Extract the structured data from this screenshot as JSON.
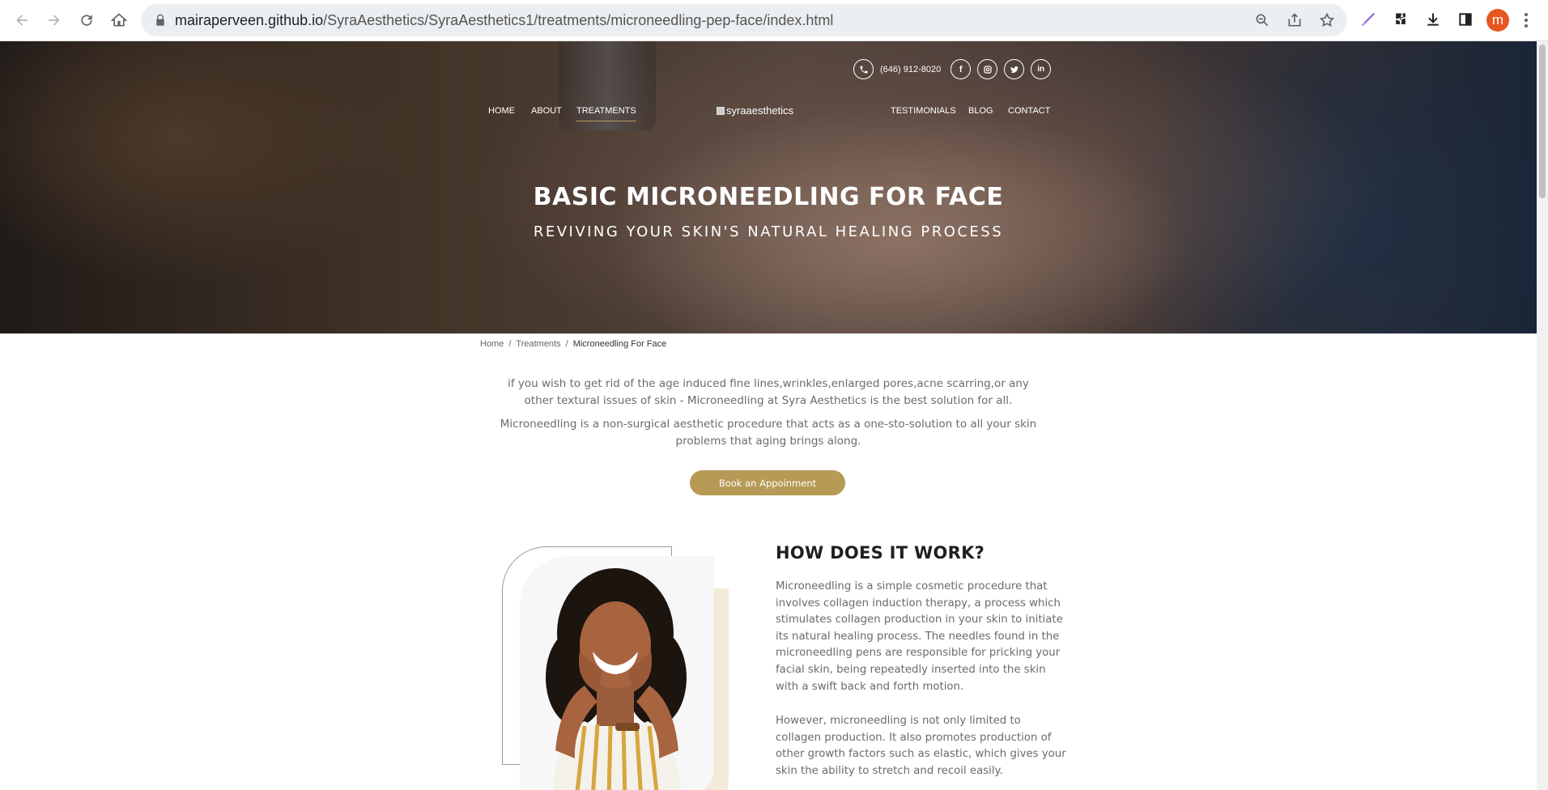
{
  "browser": {
    "url_host": "mairaperveen.github.io",
    "url_path": "/SyraAesthetics/SyraAesthetics1/treatments/microneedling-pep-face/index.html",
    "profile_initial": "m",
    "accent": "#e8561f"
  },
  "topbar": {
    "phone": "(646) 912-8020",
    "social": [
      {
        "icon": "facebook-icon",
        "glyph": "f"
      },
      {
        "icon": "instagram-icon"
      },
      {
        "icon": "twitter-icon"
      },
      {
        "icon": "linkedin-icon",
        "glyph": "in"
      }
    ]
  },
  "nav": {
    "left": [
      "HOME",
      "ABOUT",
      "TREATMENTS"
    ],
    "right": [
      "TESTIMONIALS",
      "BLOG",
      "CONTACT"
    ],
    "active": "TREATMENTS",
    "logo_alt": "syraaesthetics"
  },
  "hero": {
    "title": "BASIC MICRONEEDLING FOR FACE",
    "subtitle": "REVIVING YOUR SKIN'S NATURAL HEALING PROCESS"
  },
  "breadcrumb": {
    "items": [
      "Home",
      "Treatments"
    ],
    "separator": "/",
    "current": "Microneedling For Face"
  },
  "intro": {
    "p1": "if you wish to get rid of the age induced fine lines,wrinkles,enlarged pores,acne scarring,or any other textural issues of skin - Microneedling at Syra Aesthetics is the best solution for all.",
    "p2": "Microneedling is a non-surgical aesthetic procedure that acts as a one-sto-solution to all your skin problems that aging brings along.",
    "cta": "Book an Appoinment"
  },
  "how": {
    "title": "HOW DOES IT WORK?",
    "p1": "Microneedling is a simple cosmetic procedure that involves collagen induction therapy, a process which stimulates collagen production in your skin to initiate its natural healing process. The needles found in the microneedling pens are responsible for pricking your facial skin, being repeatedly inserted into the skin with a swift back and forth motion.",
    "p2": "However, microneedling is not only limited to collagen production. It also promotes production of other growth factors such as elastic, which gives your skin the ability to stretch and recoil easily."
  },
  "colors": {
    "gold": "#b69a55",
    "heading": "#1f1f1f",
    "body_text": "#6b6b6b"
  }
}
